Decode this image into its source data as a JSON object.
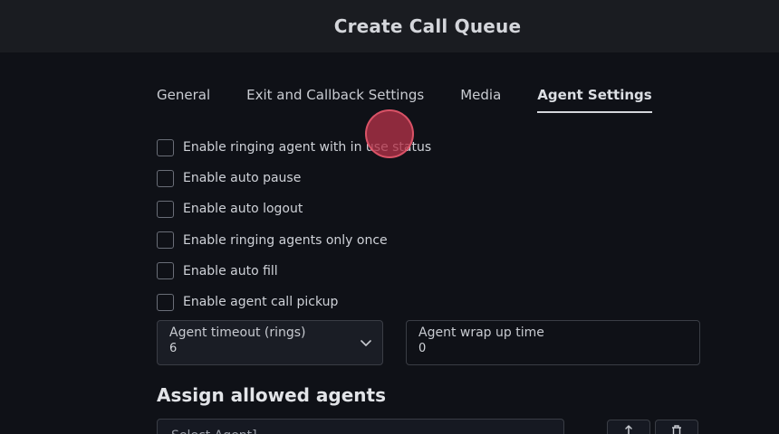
{
  "header": {
    "title": "Create Call Queue"
  },
  "tabs": [
    {
      "label": "General",
      "active": false
    },
    {
      "label": "Exit and Callback Settings",
      "active": false
    },
    {
      "label": "Media",
      "active": false
    },
    {
      "label": "Agent Settings",
      "active": true
    }
  ],
  "options": [
    {
      "label": "Enable ringing agent with in use status",
      "checked": false
    },
    {
      "label": "Enable auto pause",
      "checked": false
    },
    {
      "label": "Enable auto logout",
      "checked": false
    },
    {
      "label": "Enable ringing agents only once",
      "checked": false
    },
    {
      "label": "Enable auto fill",
      "checked": false
    },
    {
      "label": "Enable agent call pickup",
      "checked": false
    }
  ],
  "fields": {
    "agent_timeout": {
      "label": "Agent timeout (rings)",
      "value": "6"
    },
    "wrap_up": {
      "label": "Agent wrap up time",
      "value": "0"
    }
  },
  "assign": {
    "title": "Assign allowed agents",
    "select_placeholder": "Select Agent]"
  },
  "icons": {
    "dropdown": "chevron-down-icon",
    "sort": "sort-icon",
    "delete": "trash-icon"
  },
  "colors": {
    "background": "#0f1117",
    "header": "#1a1c21",
    "cursor_marker": "#b23248"
  }
}
